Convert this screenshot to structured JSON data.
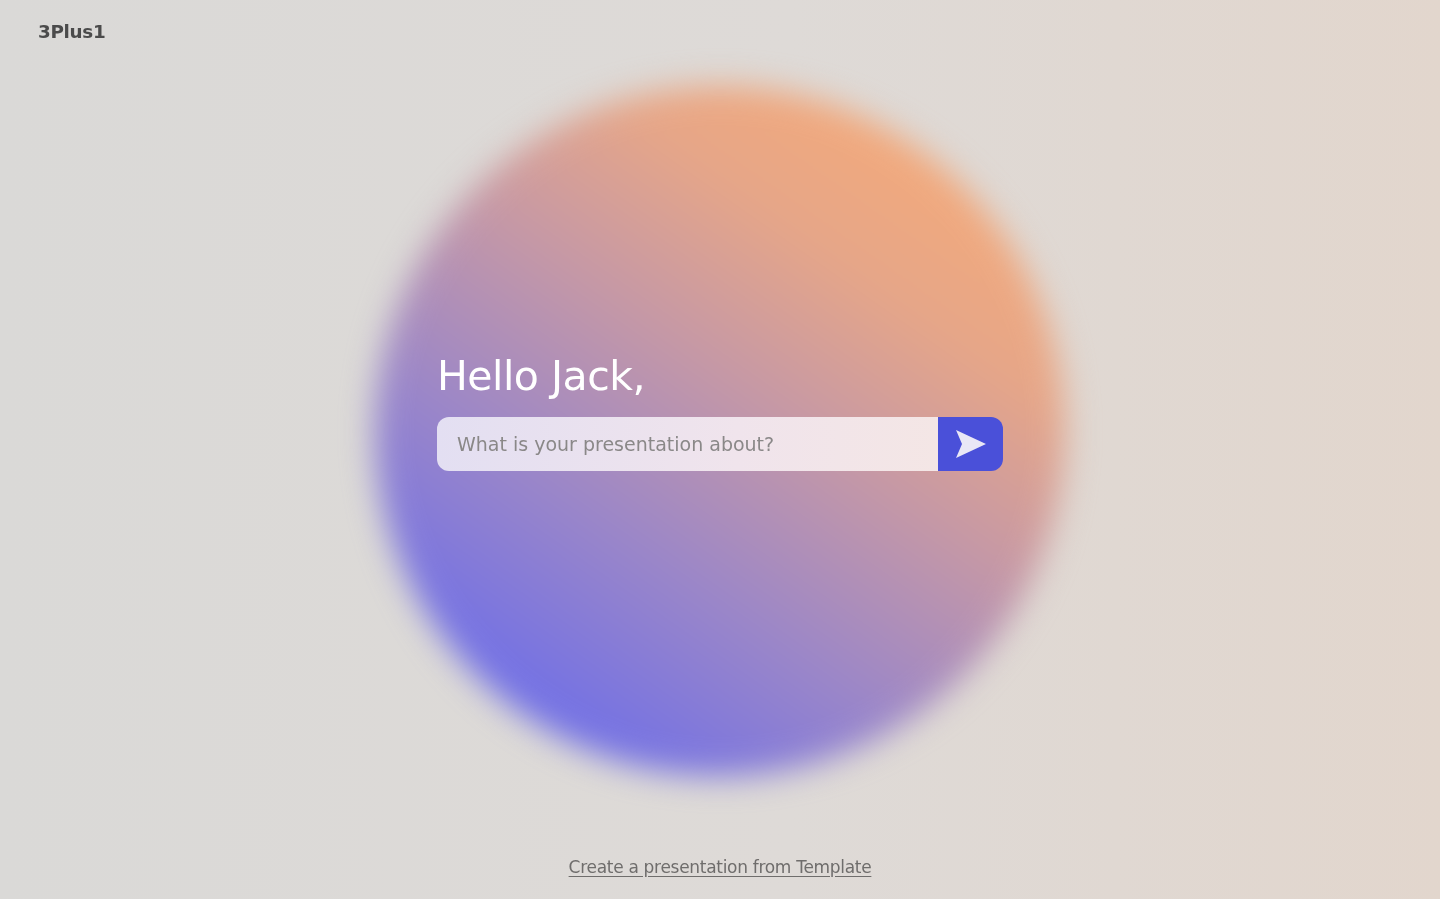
{
  "logo": {
    "text": "3Plus1"
  },
  "prompt": {
    "greeting": "Hello Jack,",
    "placeholder": "What is your presentation about?"
  },
  "footer": {
    "link": "Create a presentation from Template"
  }
}
